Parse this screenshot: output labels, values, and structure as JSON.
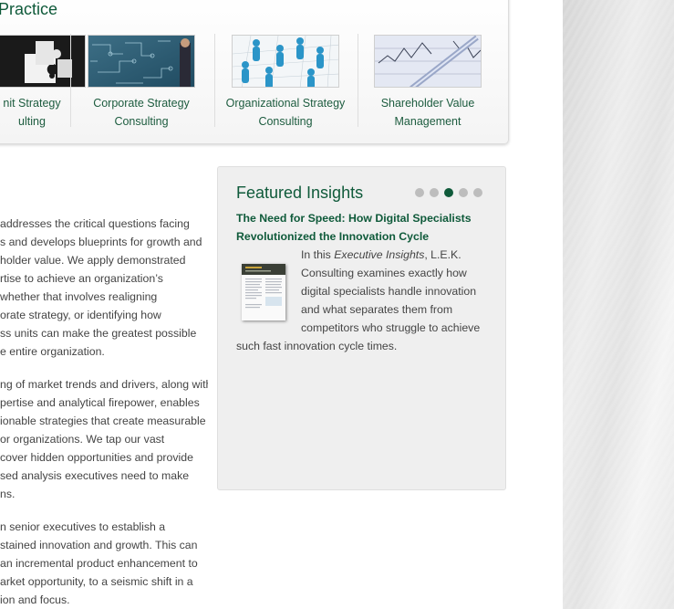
{
  "practice": {
    "heading": "Practice",
    "items": [
      {
        "line1": "nit Strategy",
        "line2": "ulting"
      },
      {
        "line1": "Corporate Strategy",
        "line2": "Consulting"
      },
      {
        "line1": "Organizational Strategy",
        "line2": "Consulting"
      },
      {
        "line1": "Shareholder Value",
        "line2": "Management"
      }
    ]
  },
  "body": {
    "paragraphs": [
      [
        " addresses the critical questions facing",
        "s and develops blueprints for growth and",
        "holder value. We apply demonstrated",
        "rtise to achieve an organization’s",
        "whether that involves realigning",
        "orate strategy, or identifying how",
        "ss units can make the greatest possible",
        "e entire organization."
      ],
      [
        "ng of market trends and drivers, along with",
        "pertise and analytical firepower, enables",
        "ionable strategies that create measurable",
        "or organizations. We tap our vast",
        "cover hidden opportunities and provide",
        "sed analysis executives need to make",
        "ns."
      ],
      [
        "n senior executives to establish a",
        "stained innovation and growth. This can",
        "an incremental product enhancement to",
        "arket opportunity, to a seismic shift in a",
        "ion and focus."
      ]
    ]
  },
  "insights": {
    "title": "Featured Insights",
    "dots": 5,
    "active_dot": 2,
    "headline": [
      "The Need for Speed: How Digital Specialists",
      "Revolutionized the Innovation Cycle"
    ],
    "body_pre": "In this ",
    "body_italic": "Executive Insights",
    "body_post": ", L.E.K.",
    "body_lines": [
      "Consulting examines exactly how",
      "digital specialists handle innovation",
      "and what separates them from",
      "competitors who struggle to achieve",
      "such fast innovation cycle times."
    ]
  },
  "colors": {
    "brand_green": "#0f5a3a",
    "panel_bg": "#efefef",
    "text": "#444444"
  },
  "icons": [
    "puzzle-image",
    "circuit-business-image",
    "people-network-image",
    "stock-chart-pen-image",
    "report-cover-image"
  ]
}
